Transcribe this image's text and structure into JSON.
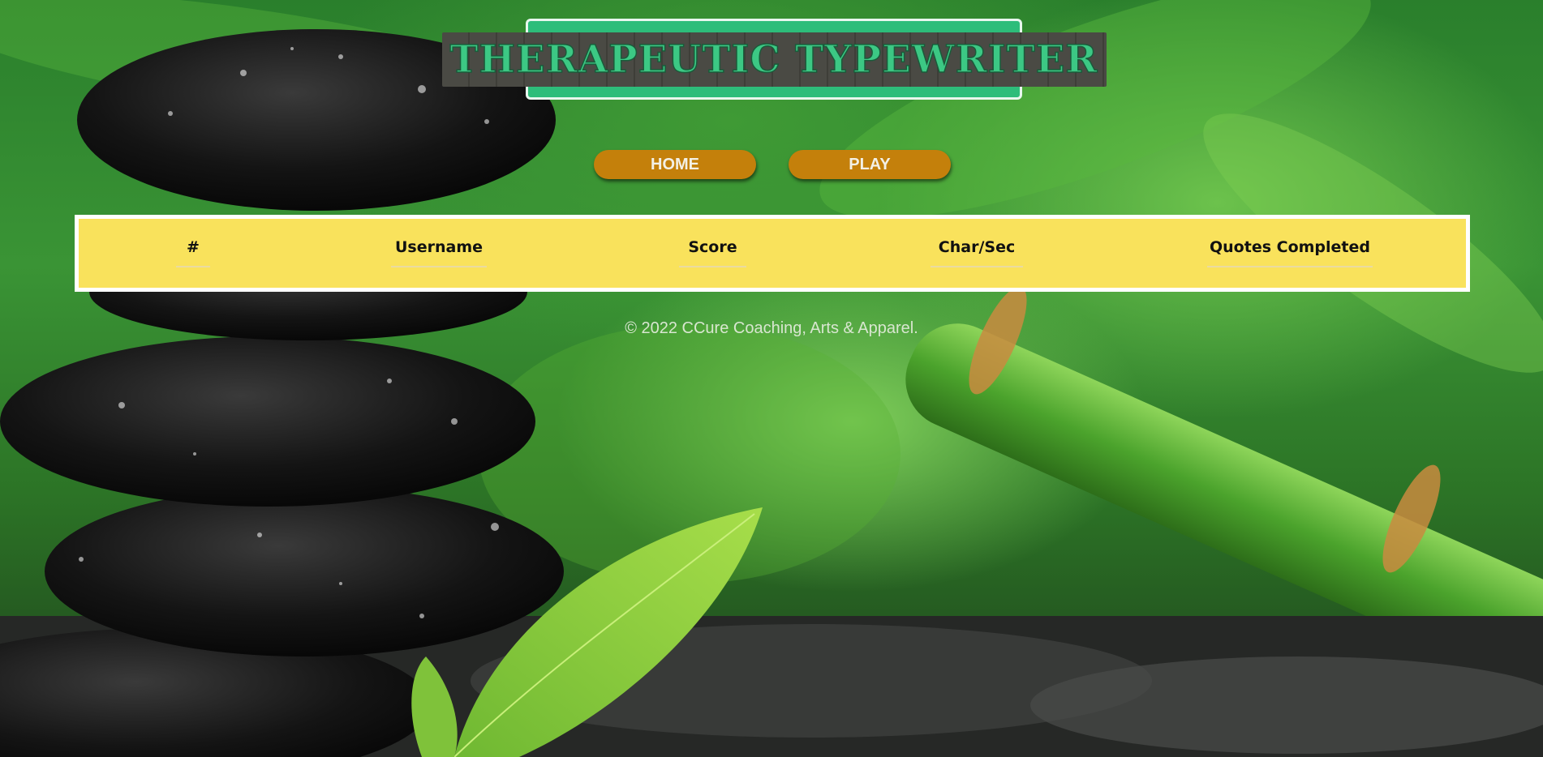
{
  "header": {
    "title": "THERAPEUTIC TYPEWRITER"
  },
  "nav": {
    "home_label": "HOME",
    "play_label": "PLAY"
  },
  "leaderboard": {
    "columns": [
      "#",
      "Username",
      "Score",
      "Char/Sec",
      "Quotes Completed"
    ],
    "rows": []
  },
  "footer": {
    "copyright": "© 2022 CCure Coaching, Arts & Apparel."
  },
  "colors": {
    "title_bg": "#2dbd7a",
    "nav_button": "#c4800b",
    "table_bg": "#f9e25c",
    "table_border": "#ffffff"
  }
}
